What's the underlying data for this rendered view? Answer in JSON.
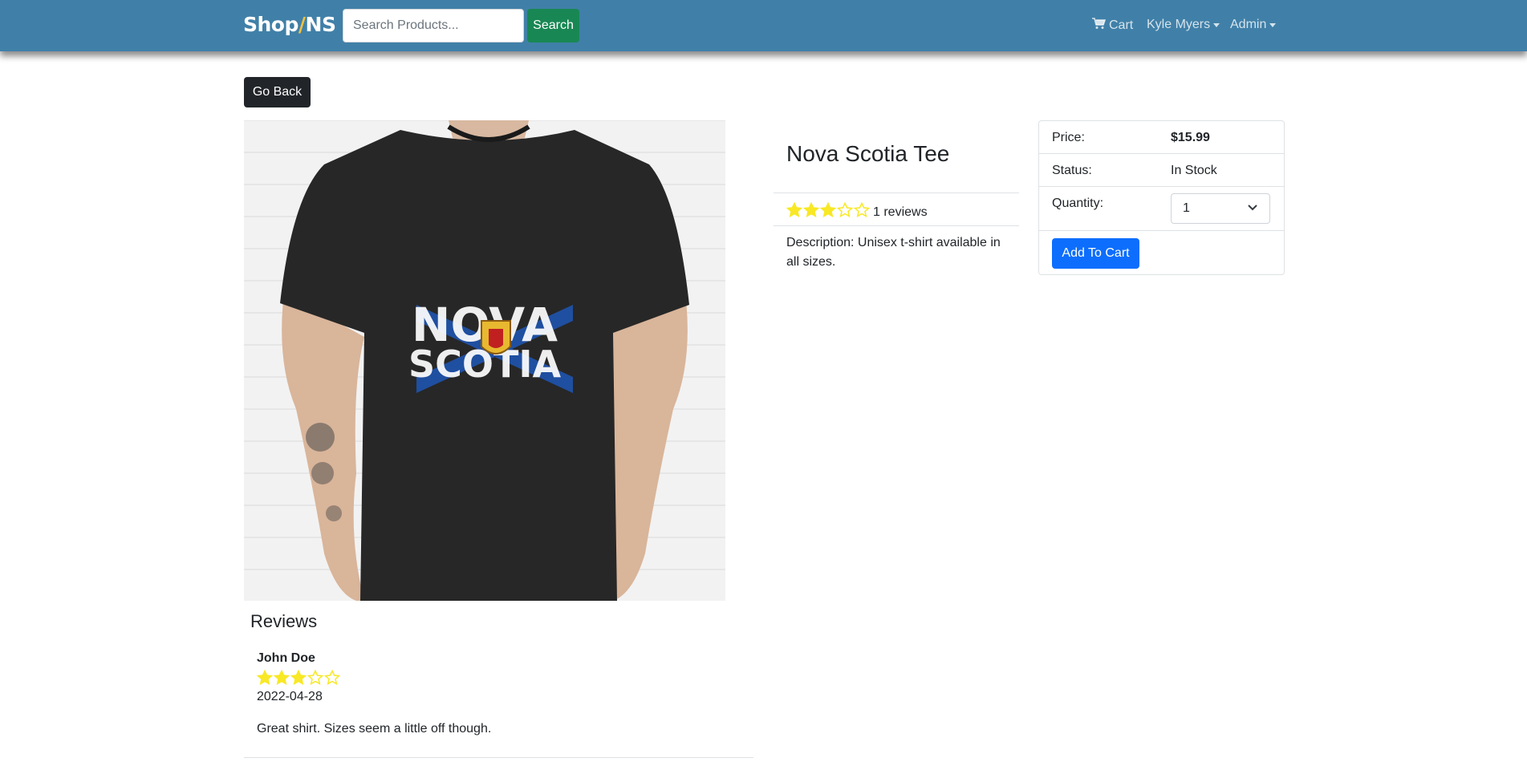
{
  "navbar": {
    "brand_left": "Shop",
    "brand_slash": "/",
    "brand_right": "NS",
    "search_placeholder": "Search Products...",
    "search_label": "Search",
    "cart_label": "Cart",
    "user_label": "Kyle Myers",
    "admin_label": "Admin"
  },
  "actions": {
    "go_back_label": "Go Back"
  },
  "product": {
    "name": "Nova Scotia Tee",
    "rating": 3,
    "max_rating": 5,
    "reviews_text": "1 reviews",
    "description": "Description: Unisex t-shirt available in all sizes.",
    "image_text_top": "NOVA",
    "image_text_bottom": "SCOTIA"
  },
  "purchase": {
    "price_label": "Price:",
    "price_value": "$15.99",
    "status_label": "Status:",
    "status_value": "In Stock",
    "quantity_label": "Quantity:",
    "quantity_value": "1",
    "add_to_cart_label": "Add To Cart"
  },
  "reviews": {
    "heading": "Reviews",
    "items": [
      {
        "name": "John Doe",
        "rating": 3,
        "date": "2022-04-28",
        "comment": "Great shirt. Sizes seem a little off though."
      }
    ]
  },
  "colors": {
    "navbar": "#4080a8",
    "search_button": "#198754",
    "primary_button": "#0d6efd",
    "dark_button": "#212529",
    "star": "#f8e825"
  },
  "icons": {
    "cart": "cart-icon",
    "star_full": "star-full-icon",
    "star_empty": "star-empty-icon",
    "dropdown": "chevron-down-icon"
  }
}
